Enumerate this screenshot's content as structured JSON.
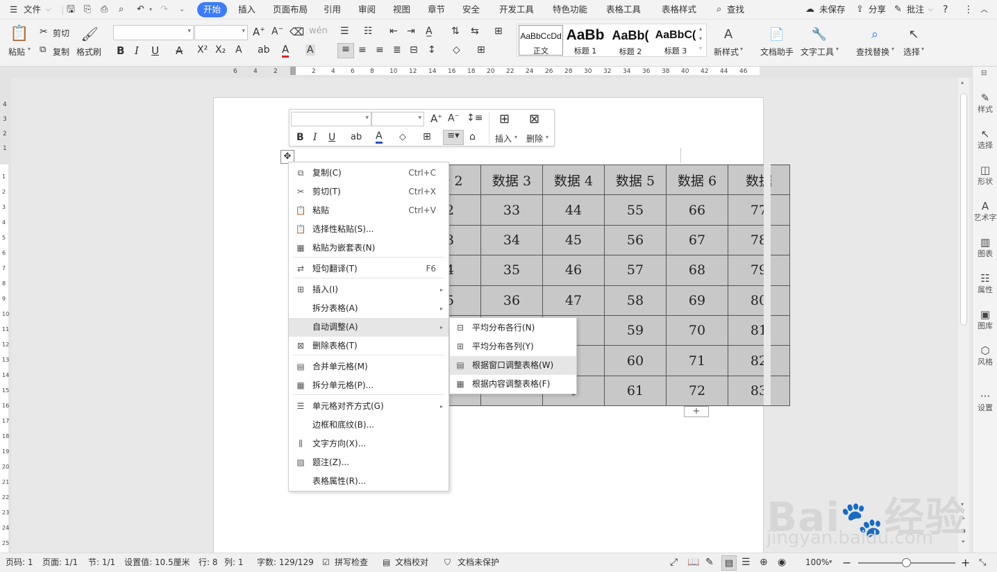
{
  "menubar": {
    "file": "文件",
    "tabs": [
      "开始",
      "插入",
      "页面布局",
      "引用",
      "审阅",
      "视图",
      "章节",
      "安全",
      "开发工具",
      "特色功能",
      "表格工具",
      "表格样式"
    ],
    "search": "查找",
    "unsaved": "未保存",
    "share": "分享",
    "review": "批注"
  },
  "ribbon": {
    "paste": "粘贴",
    "cut": "剪切",
    "copy": "复制",
    "format_painter": "格式刷",
    "styles": [
      {
        "preview": "AaBbCcDd",
        "name": "正文"
      },
      {
        "preview": "AaBb",
        "name": "标题 1"
      },
      {
        "preview": "AaBb(",
        "name": "标题 2"
      },
      {
        "preview": "AaBbC(",
        "name": "标题 3"
      }
    ],
    "new_style": "新样式",
    "doc_helper": "文档助手",
    "text_tools": "文字工具",
    "find_replace": "查找替换",
    "select": "选择"
  },
  "ruler": {
    "h_left": [
      "6",
      "4",
      "2"
    ],
    "h_right": [
      "2",
      "4",
      "6",
      "8",
      "10",
      "12",
      "14",
      "16",
      "18",
      "20",
      "22",
      "24",
      "26",
      "28",
      "30",
      "32",
      "34",
      "36",
      "38",
      "40",
      "42",
      "44",
      "46"
    ],
    "v_top": [
      "4",
      "3",
      "2",
      "1"
    ],
    "v_body": [
      "1",
      "2",
      "3",
      "4",
      "5",
      "6",
      "7",
      "8",
      "9",
      "10",
      "11",
      "12",
      "13",
      "14",
      "15",
      "16",
      "17",
      "18",
      "19",
      "20",
      "21",
      "22",
      "23",
      "24",
      "25"
    ]
  },
  "right_panel": [
    "样式",
    "选择",
    "形状",
    "艺术字",
    "图表",
    "属性",
    "图库",
    "风格",
    "设置"
  ],
  "float_toolbar": {
    "insert": "插入",
    "delete": "删除"
  },
  "table": {
    "header": [
      "据 2",
      "数据 3",
      "数据 4",
      "数据 5",
      "数据 6",
      "数据"
    ],
    "rows": [
      [
        "2",
        "33",
        "44",
        "55",
        "66",
        "77"
      ],
      [
        "3",
        "34",
        "45",
        "56",
        "67",
        "78"
      ],
      [
        "4",
        "35",
        "46",
        "57",
        "68",
        "79"
      ],
      [
        "5",
        "36",
        "47",
        "58",
        "69",
        "80"
      ],
      [
        "",
        "",
        "3",
        "59",
        "70",
        "81"
      ],
      [
        "",
        "",
        "9",
        "60",
        "71",
        "82"
      ],
      [
        "",
        "",
        "0",
        "61",
        "72",
        "83"
      ]
    ],
    "add_row": "+"
  },
  "context_menu": [
    {
      "label": "复制(C)",
      "shortcut": "Ctrl+C",
      "icon": "copy-icon"
    },
    {
      "label": "剪切(T)",
      "shortcut": "Ctrl+X",
      "icon": "scissors-icon"
    },
    {
      "label": "粘贴",
      "shortcut": "Ctrl+V",
      "icon": "paste-icon"
    },
    {
      "label": "选择性粘贴(S)...",
      "shortcut": "",
      "icon": "paste-special-icon"
    },
    {
      "label": "粘贴为嵌套表(N)",
      "shortcut": "",
      "icon": "nested-table-icon"
    },
    {
      "label": "短句翻译(T)",
      "shortcut": "F6",
      "icon": "translate-icon"
    },
    {
      "label": "插入(I)",
      "shortcut": "",
      "icon": "table-insert-icon",
      "submenu": true
    },
    {
      "label": "拆分表格(A)",
      "shortcut": "",
      "icon": "",
      "submenu": true
    },
    {
      "label": "自动调整(A)",
      "shortcut": "",
      "icon": "",
      "submenu": true,
      "highlight": true
    },
    {
      "label": "删除表格(T)",
      "shortcut": "",
      "icon": "table-delete-icon"
    },
    {
      "label": "合并单元格(M)",
      "shortcut": "",
      "icon": "merge-cells-icon"
    },
    {
      "label": "拆分单元格(P)...",
      "shortcut": "",
      "icon": "split-cells-icon"
    },
    {
      "label": "单元格对齐方式(G)",
      "shortcut": "",
      "icon": "cell-align-icon",
      "submenu": true
    },
    {
      "label": "边框和底纹(B)...",
      "shortcut": "",
      "icon": ""
    },
    {
      "label": "文字方向(X)...",
      "shortcut": "",
      "icon": "text-direction-icon"
    },
    {
      "label": "题注(Z)...",
      "shortcut": "",
      "icon": "caption-icon"
    },
    {
      "label": "表格属性(R)...",
      "shortcut": "",
      "icon": ""
    }
  ],
  "submenu": [
    {
      "label": "平均分布各行(N)",
      "icon": "distribute-rows-icon"
    },
    {
      "label": "平均分布各列(Y)",
      "icon": "distribute-columns-icon"
    },
    {
      "label": "根据窗口调整表格(W)",
      "icon": "fit-window-icon",
      "highlight": true
    },
    {
      "label": "根据内容调整表格(F)",
      "icon": "fit-content-icon"
    }
  ],
  "statusbar": {
    "page_num": "页码: 1",
    "pages": "页面: 1/1",
    "section": "节: 1/1",
    "setting": "设置值: 10.5厘米",
    "row": "行: 8",
    "col": "列: 1",
    "words": "字数: 129/129",
    "spell": "拼写检查",
    "proof": "文档校对",
    "protect": "文档未保护",
    "zoom": "100%"
  },
  "watermark": {
    "brand": "Bai",
    "brand2": "经验",
    "url": "jingyan.baidu.com"
  },
  "colors": {
    "accent": "#3e7bfa",
    "table_fill": "#c8c8c8",
    "menu_highlight": "#e6e6e6"
  }
}
